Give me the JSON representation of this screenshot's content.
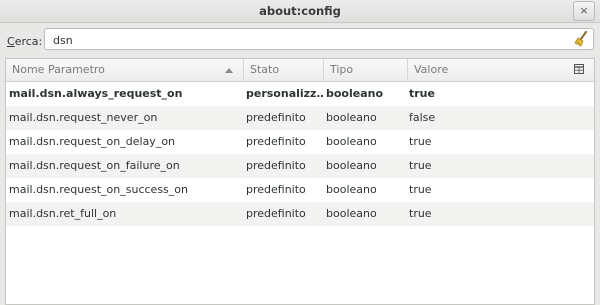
{
  "window": {
    "title": "about:config",
    "close_glyph": "×"
  },
  "search": {
    "label_mnemonic": "C",
    "label_rest": "erca:",
    "value": "dsn",
    "clear_icon": "broom-icon"
  },
  "columns": {
    "name": "Nome Parametro",
    "state": "Stato",
    "type": "Tipo",
    "value": "Valore"
  },
  "rows": [
    {
      "name": "mail.dsn.always_request_on",
      "state": "personalizz…",
      "type": "booleano",
      "value": "true",
      "modified": true
    },
    {
      "name": "mail.dsn.request_never_on",
      "state": "predefinito",
      "type": "booleano",
      "value": "false",
      "modified": false
    },
    {
      "name": "mail.dsn.request_on_delay_on",
      "state": "predefinito",
      "type": "booleano",
      "value": "true",
      "modified": false
    },
    {
      "name": "mail.dsn.request_on_failure_on",
      "state": "predefinito",
      "type": "booleano",
      "value": "true",
      "modified": false
    },
    {
      "name": "mail.dsn.request_on_success_on",
      "state": "predefinito",
      "type": "booleano",
      "value": "true",
      "modified": false
    },
    {
      "name": "mail.dsn.ret_full_on",
      "state": "predefinito",
      "type": "booleano",
      "value": "true",
      "modified": false
    }
  ]
}
